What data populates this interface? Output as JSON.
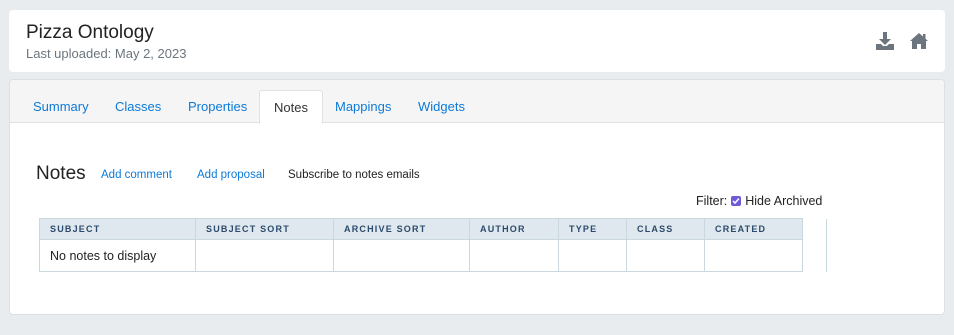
{
  "header": {
    "title": "Pizza Ontology",
    "subtitle": "Last uploaded: May 2, 2023",
    "icons": {
      "download": "download-icon",
      "home": "home-icon"
    }
  },
  "tabs": [
    {
      "label": "Summary",
      "active": false
    },
    {
      "label": "Classes",
      "active": false
    },
    {
      "label": "Properties",
      "active": false
    },
    {
      "label": "Notes",
      "active": true
    },
    {
      "label": "Mappings",
      "active": false
    },
    {
      "label": "Widgets",
      "active": false
    }
  ],
  "notes": {
    "heading": "Notes",
    "add_comment": "Add comment",
    "add_proposal": "Add proposal",
    "subscribe": "Subscribe to notes emails",
    "filter_label": "Filter:",
    "hide_archived_label": "Hide Archived",
    "hide_archived_checked": true,
    "table": {
      "columns": [
        "SUBJECT",
        "SUBJECT SORT",
        "ARCHIVE SORT",
        "AUTHOR",
        "TYPE",
        "CLASS",
        "CREATED"
      ],
      "empty_message": "No notes to display"
    }
  },
  "colors": {
    "link": "#0d7ad8",
    "background": "#e9ecef",
    "table_header_bg": "#dfe8ee",
    "checkbox": "#6f5bd6"
  }
}
